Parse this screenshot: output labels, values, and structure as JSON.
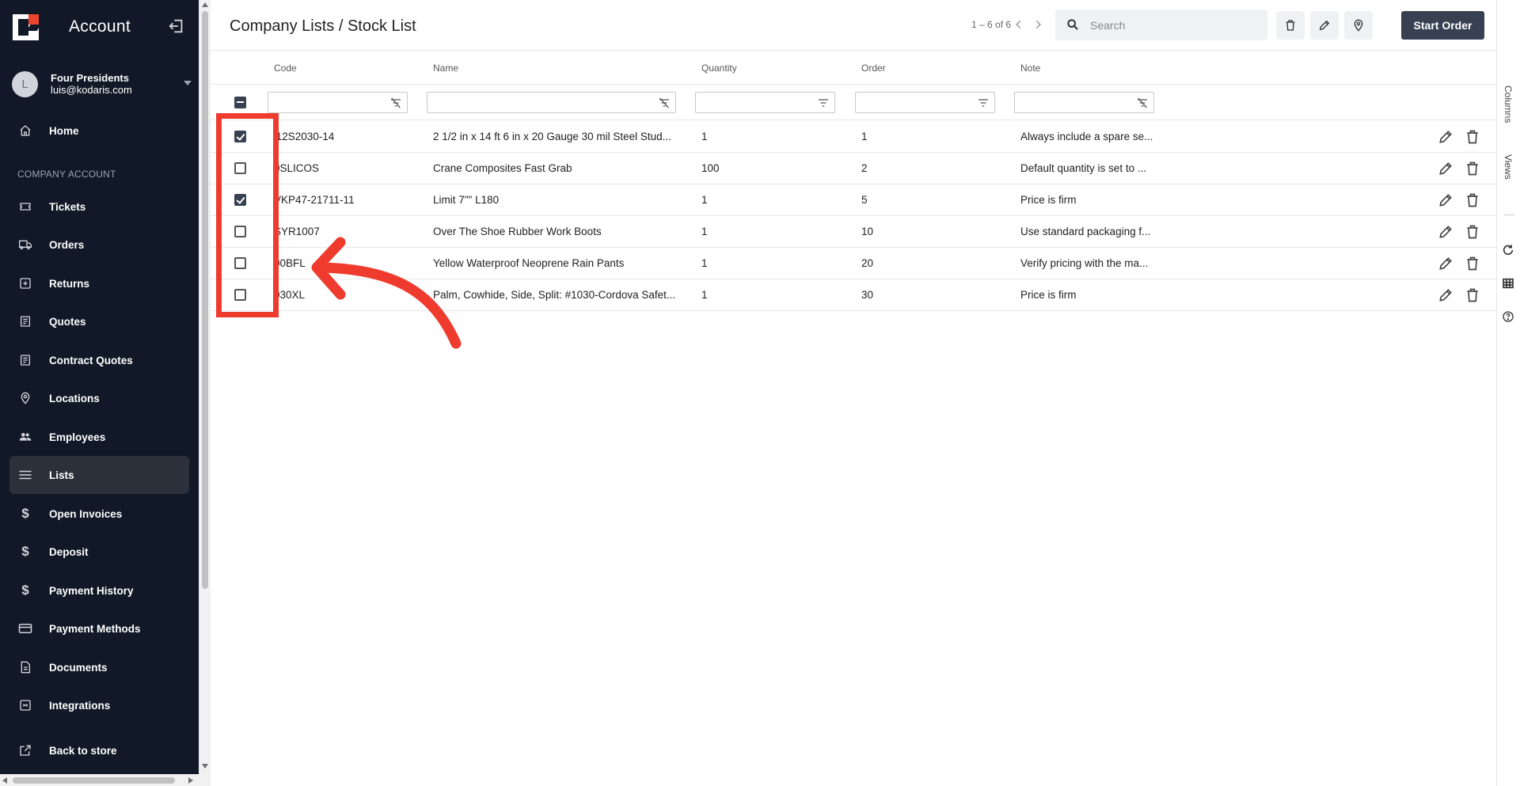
{
  "sidebar": {
    "title": "Account",
    "user": {
      "initial": "L",
      "name": "Four Presidents",
      "email": "luis@kodaris.com"
    },
    "section_label": "COMPANY ACCOUNT",
    "items": [
      {
        "label": "Home",
        "icon": "home-icon"
      },
      {
        "label": "Tickets",
        "icon": "ticket-icon"
      },
      {
        "label": "Orders",
        "icon": "truck-icon"
      },
      {
        "label": "Returns",
        "icon": "return-icon"
      },
      {
        "label": "Quotes",
        "icon": "document-icon"
      },
      {
        "label": "Contract Quotes",
        "icon": "document-icon"
      },
      {
        "label": "Locations",
        "icon": "location-pin-icon"
      },
      {
        "label": "Employees",
        "icon": "people-icon"
      },
      {
        "label": "Lists",
        "icon": "list-icon",
        "active": true
      },
      {
        "label": "Open Invoices",
        "icon": "dollar-icon"
      },
      {
        "label": "Deposit",
        "icon": "dollar-icon"
      },
      {
        "label": "Payment History",
        "icon": "dollar-icon"
      },
      {
        "label": "Payment Methods",
        "icon": "credit-card-icon"
      },
      {
        "label": "Documents",
        "icon": "file-icon"
      },
      {
        "label": "Integrations",
        "icon": "integration-icon"
      }
    ],
    "back_label": "Back to store"
  },
  "header": {
    "title": "Company Lists / Stock List",
    "pager": "1 – 6 of 6",
    "search_placeholder": "Search",
    "start_order_label": "Start Order"
  },
  "table": {
    "columns": [
      "Code",
      "Name",
      "Quantity",
      "Order",
      "Note"
    ],
    "rows": [
      {
        "checked": true,
        "code": " 12S2030-14",
        "name": "2 1/2 in x 14 ft 6 in x 20 Gauge 30 mil Steel Stud...",
        "quantity": "1",
        "order": "1",
        "note": "Always include a spare se..."
      },
      {
        "checked": false,
        "code": "0SLICOS",
        "name": "Crane Composites Fast Grab",
        "quantity": "100",
        "order": "2",
        "note": "Default quantity is set to ..."
      },
      {
        "checked": true,
        "code": "VKP47-21711-11",
        "name": "Limit 7\"\" L180",
        "quantity": "1",
        "order": "5",
        "note": "Price is firm"
      },
      {
        "checked": false,
        "code": "SYR1007",
        "name": "Over The Shoe Rubber Work Boots",
        "quantity": "1",
        "order": "10",
        "note": "Use standard packaging f..."
      },
      {
        "checked": false,
        "code": "00BFL",
        "name": "Yellow Waterproof Neoprene Rain Pants",
        "quantity": "1",
        "order": "20",
        "note": "Verify pricing with the ma..."
      },
      {
        "checked": false,
        "code": "030XL",
        "name": "Palm, Cowhide, Side, Split: #1030-Cordova Safet...",
        "quantity": "1",
        "order": "30",
        "note": "Price is firm"
      }
    ]
  },
  "right_panel": {
    "columns_label": "Columns",
    "views_label": "Views"
  },
  "colors": {
    "sidebar_bg": "#111827",
    "primary_button": "#374151",
    "annotation": "#ef3b2d",
    "logo_accent": "#e8452c"
  }
}
